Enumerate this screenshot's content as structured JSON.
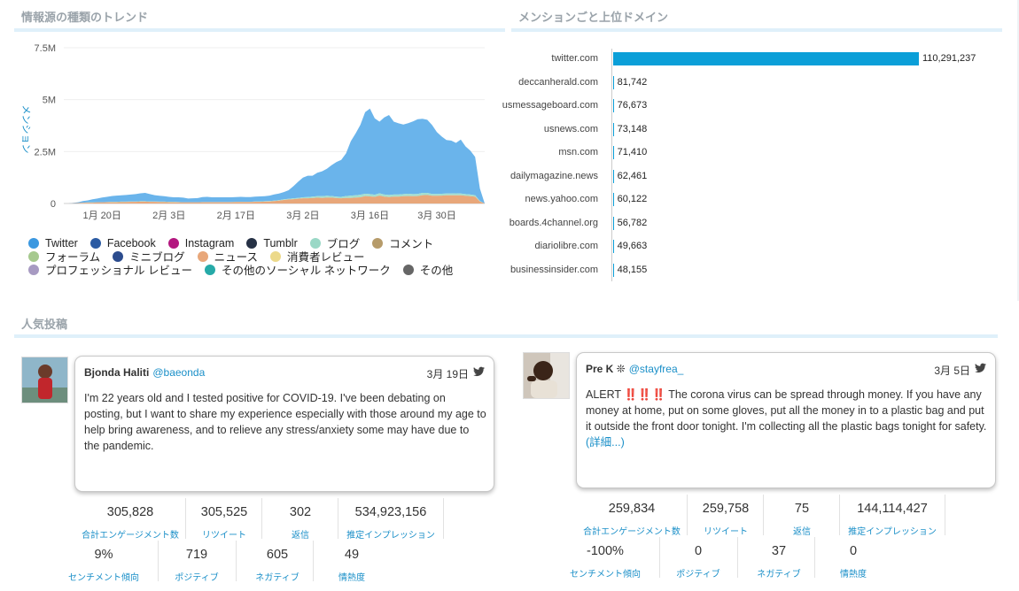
{
  "panels": {
    "trend_title": "情報源の種類のトレンド",
    "domains_title": "メンションごと上位ドメイン",
    "posts_title": "人気投稿"
  },
  "chart_data": [
    {
      "type": "area",
      "title": "",
      "ylabel": "メンション",
      "ylim": [
        0,
        7500000
      ],
      "yticks": [
        "7.5M",
        "5M",
        "2.5M",
        "0"
      ],
      "ytick_values": [
        7500000,
        5000000,
        2500000,
        0
      ],
      "xticks": [
        "1月 20日",
        "2月 3日",
        "2月 17日",
        "3月 2日",
        "3月 16日",
        "3月 30日"
      ],
      "xtick_index": [
        8,
        22,
        36,
        50,
        64,
        78
      ],
      "x_days": 89,
      "series": [
        {
          "name": "ニュース",
          "color": "#e8a77a",
          "values": [
            0,
            0,
            10000,
            20000,
            30000,
            40000,
            40000,
            50000,
            50000,
            60000,
            60000,
            60000,
            70000,
            70000,
            80000,
            80000,
            90000,
            90000,
            80000,
            80000,
            70000,
            70000,
            60000,
            60000,
            50000,
            50000,
            50000,
            50000,
            50000,
            60000,
            60000,
            60000,
            60000,
            60000,
            60000,
            60000,
            70000,
            70000,
            70000,
            70000,
            80000,
            80000,
            90000,
            100000,
            120000,
            140000,
            170000,
            190000,
            210000,
            230000,
            250000,
            250000,
            260000,
            280000,
            270000,
            280000,
            280000,
            260000,
            250000,
            270000,
            270000,
            280000,
            300000,
            360000,
            340000,
            320000,
            380000,
            330000,
            310000,
            330000,
            330000,
            350000,
            360000,
            350000,
            360000,
            400000,
            410000,
            370000,
            370000,
            380000,
            390000,
            390000,
            390000,
            390000,
            370000,
            350000,
            330000,
            100000,
            0
          ]
        },
        {
          "name": "ブログ",
          "color": "#a3dfd0",
          "values": [
            0,
            0,
            0,
            0,
            10000,
            10000,
            10000,
            10000,
            10000,
            10000,
            20000,
            20000,
            20000,
            20000,
            20000,
            20000,
            20000,
            20000,
            20000,
            20000,
            20000,
            20000,
            20000,
            20000,
            20000,
            10000,
            10000,
            10000,
            10000,
            10000,
            10000,
            10000,
            10000,
            10000,
            10000,
            10000,
            10000,
            10000,
            10000,
            10000,
            20000,
            20000,
            20000,
            20000,
            20000,
            20000,
            30000,
            30000,
            40000,
            40000,
            50000,
            60000,
            70000,
            70000,
            80000,
            90000,
            80000,
            70000,
            70000,
            90000,
            110000,
            110000,
            120000,
            110000,
            110000,
            100000,
            110000,
            100000,
            100000,
            100000,
            100000,
            100000,
            110000,
            100000,
            100000,
            110000,
            100000,
            90000,
            90000,
            90000,
            90000,
            90000,
            100000,
            90000,
            80000,
            80000,
            70000,
            20000,
            0
          ]
        },
        {
          "name": "Twitter",
          "color": "#6ab4eb",
          "values": [
            0,
            0,
            20000,
            40000,
            80000,
            100000,
            150000,
            180000,
            230000,
            250000,
            280000,
            300000,
            300000,
            320000,
            330000,
            350000,
            380000,
            400000,
            350000,
            300000,
            280000,
            260000,
            240000,
            220000,
            230000,
            220000,
            180000,
            190000,
            200000,
            240000,
            250000,
            230000,
            230000,
            230000,
            230000,
            230000,
            230000,
            240000,
            230000,
            230000,
            230000,
            240000,
            240000,
            260000,
            300000,
            320000,
            350000,
            420000,
            580000,
            780000,
            950000,
            1030000,
            1010000,
            1130000,
            1200000,
            1300000,
            1490000,
            1670000,
            1780000,
            2050000,
            2620000,
            2980000,
            3370000,
            3930000,
            4120000,
            3680000,
            3450000,
            3710000,
            3850000,
            3510000,
            3430000,
            3350000,
            3400000,
            3500000,
            3600000,
            3570000,
            3520000,
            3320000,
            2980000,
            2760000,
            2580000,
            2550000,
            2430000,
            2600000,
            2300000,
            2120000,
            1840000,
            600000,
            0
          ]
        }
      ]
    },
    {
      "type": "bar",
      "orientation": "horizontal",
      "title": "",
      "categories": [
        "twitter.com",
        "deccanherald.com",
        "usmessageboard.com",
        "usnews.com",
        "msn.com",
        "dailymagazine.news",
        "news.yahoo.com",
        "boards.4channel.org",
        "diariolibre.com",
        "businessinsider.com"
      ],
      "values": [
        110291237,
        81742,
        76673,
        73148,
        71410,
        62461,
        60122,
        56782,
        49663,
        48155
      ],
      "value_labels": [
        "110,291,237",
        "81,742",
        "76,673",
        "73,148",
        "71,410",
        "62,461",
        "60,122",
        "56,782",
        "49,663",
        "48,155"
      ],
      "bar_color": "#0b9fd8"
    }
  ],
  "legend": [
    [
      {
        "label": "Twitter",
        "color": "#3b98e0"
      },
      {
        "label": "Facebook",
        "color": "#2b5ba3"
      },
      {
        "label": "Instagram",
        "color": "#b3177f"
      },
      {
        "label": "Tumblr",
        "color": "#263145"
      },
      {
        "label": "ブログ",
        "color": "#9ad8c6"
      },
      {
        "label": "コメント",
        "color": "#b69b6a"
      }
    ],
    [
      {
        "label": "フォーラム",
        "color": "#a6c98e"
      },
      {
        "label": "ミニブログ",
        "color": "#2c4c8e"
      },
      {
        "label": "ニュース",
        "color": "#e8a77a"
      },
      {
        "label": "消費者レビュー",
        "color": "#ecd98a"
      }
    ],
    [
      {
        "label": "プロフェッショナル レビュー",
        "color": "#a79ac2"
      },
      {
        "label": "その他のソーシャル ネットワーク",
        "color": "#26aaa8"
      },
      {
        "label": "その他",
        "color": "#666666"
      }
    ]
  ],
  "posts": [
    {
      "author": "Bjonda Haliti",
      "handle": "@baeonda",
      "date": "3月 19日",
      "text": "I'm 22 years old and I tested positive for COVID-19. I've been debating on posting, but I want to share my experience especially with those around my age to help bring awareness, and to relieve any stress/anxiety some may have due to the pandemic.",
      "more": "",
      "stats_row1": [
        {
          "num": "305,828",
          "lbl": "合計エンゲージメント数"
        },
        {
          "num": "305,525",
          "lbl": "リツイート"
        },
        {
          "num": "302",
          "lbl": "返信"
        },
        {
          "num": "534,923,156",
          "lbl": "推定インプレッション"
        }
      ],
      "stats_row2": [
        {
          "num": "9%",
          "lbl": "センチメント傾向"
        },
        {
          "num": "719",
          "lbl": "ポジティブ"
        },
        {
          "num": "605",
          "lbl": "ネガティブ"
        },
        {
          "num": "49",
          "lbl": "情熱度"
        }
      ]
    },
    {
      "author": "Pre K ❊",
      "handle": "@stayfrea_",
      "date": "3月 5日",
      "text": "ALERT ‼️‼️‼️ The corona virus can be spread through money. If you have any money at home, put on some gloves, put all the money in to a plastic bag and put it outside the front door tonight. I'm collecting all the plastic bags tonight for safety.",
      "more": "(詳細...)",
      "stats_row1": [
        {
          "num": "259,834",
          "lbl": "合計エンゲージメント数"
        },
        {
          "num": "259,758",
          "lbl": "リツイート"
        },
        {
          "num": "75",
          "lbl": "返信"
        },
        {
          "num": "144,114,427",
          "lbl": "推定インプレッション"
        }
      ],
      "stats_row2": [
        {
          "num": "-100%",
          "lbl": "センチメント傾向"
        },
        {
          "num": "0",
          "lbl": "ポジティブ"
        },
        {
          "num": "37",
          "lbl": "ネガティブ"
        },
        {
          "num": "0",
          "lbl": "情熱度"
        }
      ]
    }
  ]
}
